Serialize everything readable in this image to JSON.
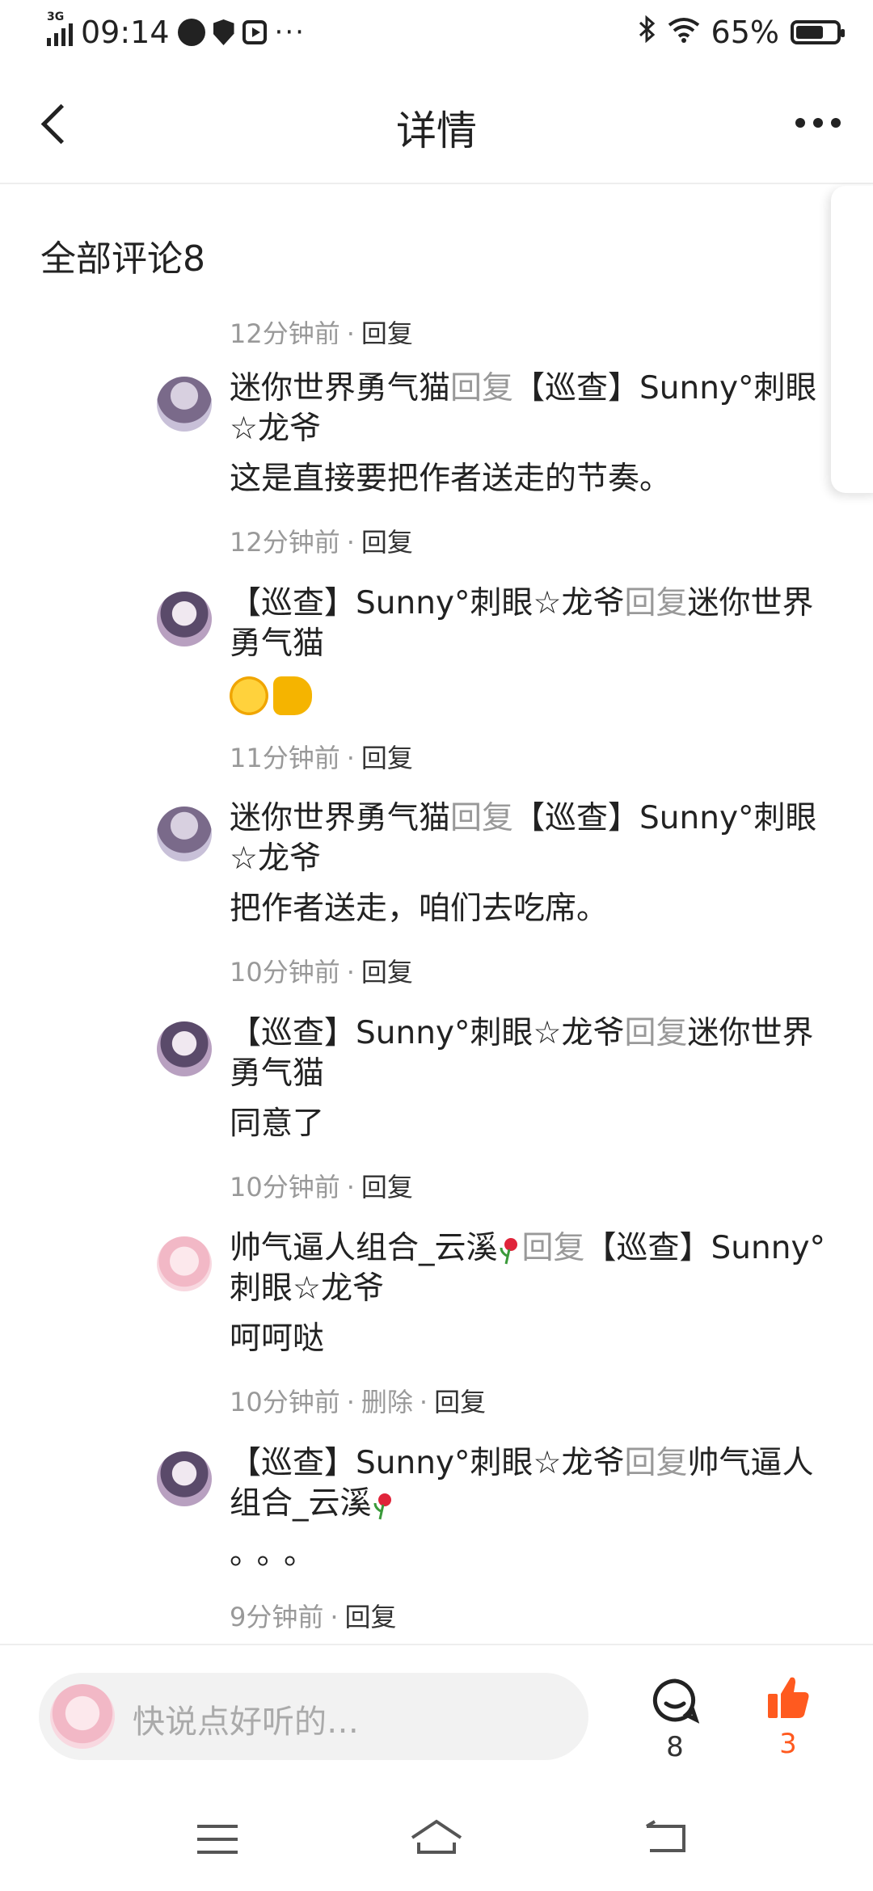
{
  "status_bar": {
    "network": "3G",
    "time": "09:14",
    "battery": "65%"
  },
  "nav": {
    "title": "详情"
  },
  "section": {
    "title": "全部评论8"
  },
  "top_meta": {
    "time": "12分钟前",
    "reply": "回复"
  },
  "comments": [
    {
      "user": "迷你世界勇气猫",
      "reply_word": "回复",
      "target": "【巡查】Sunny°刺眼☆龙爷",
      "text": "这是直接要把作者送走的节奏。",
      "time": "12分钟前",
      "action": "回复"
    },
    {
      "user": "【巡查】Sunny°刺眼☆龙爷",
      "reply_word": "回复",
      "target": "迷你世界勇气猫",
      "text": "",
      "time": "11分钟前",
      "action": "回复"
    },
    {
      "user": "迷你世界勇气猫",
      "reply_word": "回复",
      "target": "【巡查】Sunny°刺眼☆龙爷",
      "text": "把作者送走，咱们去吃席。",
      "time": "10分钟前",
      "action": "回复"
    },
    {
      "user": "【巡查】Sunny°刺眼☆龙爷",
      "reply_word": "回复",
      "target": "迷你世界勇气猫",
      "text": "同意了",
      "time": "10分钟前",
      "action": "回复"
    },
    {
      "user": "帅气逼人组合_云溪",
      "reply_word": "回复",
      "target": "【巡查】Sunny°刺眼☆龙爷",
      "text": "呵呵哒",
      "time": "10分钟前",
      "delete": "删除",
      "action": "回复"
    },
    {
      "user": "【巡查】Sunny°刺眼☆龙爷",
      "reply_word": "回复",
      "target": "帅气逼人组合_云溪",
      "text": "。。。",
      "time": "9分钟前",
      "action": "回复"
    }
  ],
  "bottom": {
    "placeholder": "快说点好听的…",
    "comment_count": "8",
    "like_count": "3"
  },
  "colors": {
    "accent": "#ff5a1f",
    "muted": "#999999"
  }
}
